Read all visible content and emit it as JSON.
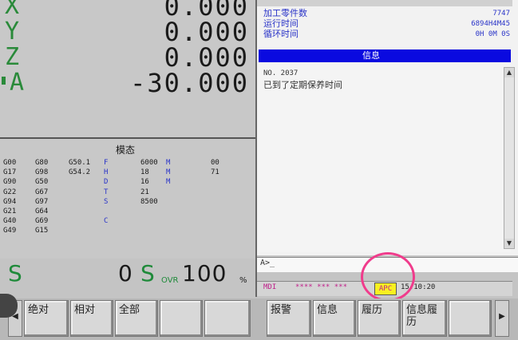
{
  "axes": [
    {
      "name": "X",
      "value": "0.000"
    },
    {
      "name": "Y",
      "value": "0.000"
    },
    {
      "name": "Z",
      "value": "0.000"
    },
    {
      "name": "A",
      "value": "-30.000"
    }
  ],
  "modal": {
    "title": "模态",
    "col1": [
      "G00",
      "G17",
      "G90",
      "G22",
      "G94",
      "G21",
      "G40",
      "G49"
    ],
    "col2": [
      "G80",
      "G98",
      "G50",
      "G67",
      "G97",
      "G64",
      "G69",
      "G15"
    ],
    "col3": [
      "G50.1",
      "G54.2",
      "",
      "",
      "",
      "",
      "",
      ""
    ],
    "col3b": [
      "F",
      "H",
      "D",
      "T",
      "S",
      "",
      "C",
      ""
    ],
    "col4": [
      "6000",
      "18",
      "16",
      "21",
      "8500",
      "",
      "",
      ""
    ],
    "col4b": [
      "M",
      "M",
      "M",
      "",
      "",
      "",
      "",
      ""
    ],
    "col5": [
      "00",
      "71",
      "",
      "",
      "",
      "",
      "",
      ""
    ]
  },
  "spindle": {
    "s_label": "S",
    "s_value": "0",
    "sovr_label": "S",
    "sovr_sub": "OVR",
    "sovr_value": "100",
    "pct": "%"
  },
  "info": {
    "top_number": "",
    "rows": [
      {
        "label": "加工零件数",
        "value": "7747"
      },
      {
        "label": "运行时间",
        "value": "6894H4M45"
      },
      {
        "label": "循环时间",
        "value": "0H 0M 0S"
      }
    ],
    "message_bar_label": "信息",
    "message_code": "NO. 2037",
    "message_text": "已到了定期保养时间"
  },
  "input_prompt": "A>_",
  "status": {
    "mode": "MDI",
    "stars": "**** *** ***",
    "apc": "APC",
    "time": "15:10:20"
  },
  "softkeys_left": [
    "绝对",
    "相对",
    "全部",
    "",
    ""
  ],
  "softkeys_right": [
    "报警",
    "信息",
    "履历",
    "信息履历",
    ""
  ],
  "arrow_left": "◀",
  "arrow_right": "▶"
}
